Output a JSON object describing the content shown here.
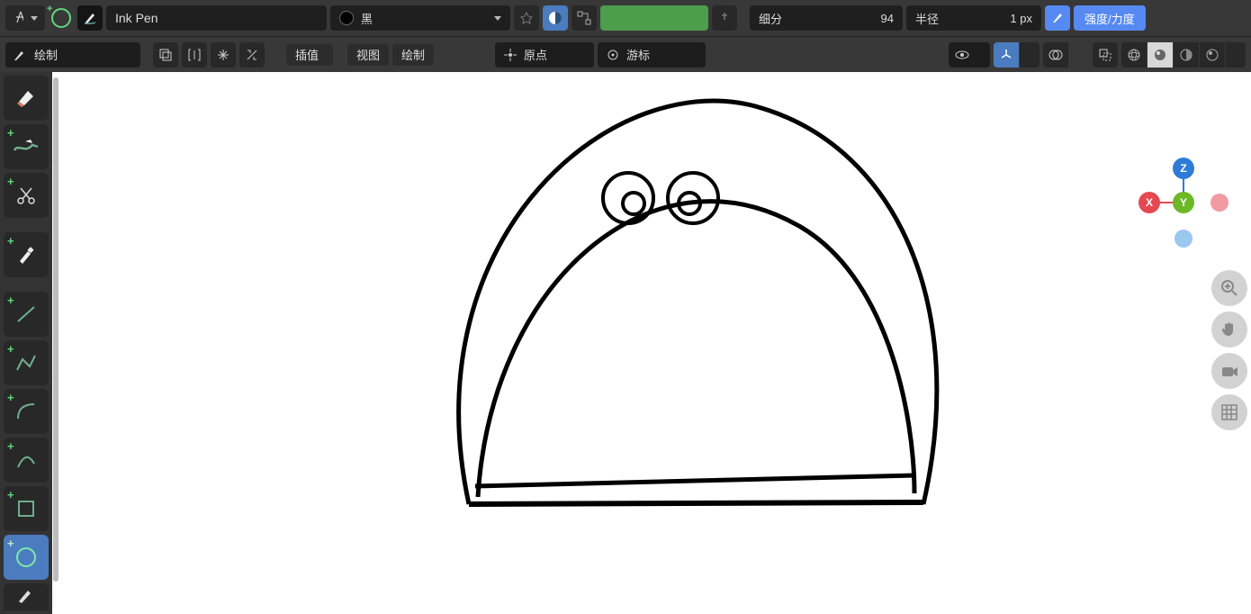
{
  "topbar": {
    "brush_name": "Ink Pen",
    "color_name": "黑",
    "subdiv_label": "细分",
    "subdiv_value": "94",
    "radius_label": "半径",
    "radius_value": "1 px",
    "strength_label": "强度/力度"
  },
  "secondbar": {
    "mode_label": "绘制",
    "interp_label": "插值",
    "view_label": "视图",
    "draw_label": "绘制",
    "origin_label": "原点",
    "cursor_label": "游标"
  },
  "gizmo": {
    "x": "X",
    "y": "Y",
    "z": "Z"
  },
  "tools": [
    {
      "name": "eraser-tool"
    },
    {
      "name": "fill-tool"
    },
    {
      "name": "cut-tool"
    },
    {
      "name": "eyedropper-tool"
    },
    {
      "name": "line-tool"
    },
    {
      "name": "polyline-tool"
    },
    {
      "name": "arc-tool"
    },
    {
      "name": "curve-tool"
    },
    {
      "name": "box-tool"
    },
    {
      "name": "circle-tool"
    },
    {
      "name": "annotate-tool"
    }
  ]
}
